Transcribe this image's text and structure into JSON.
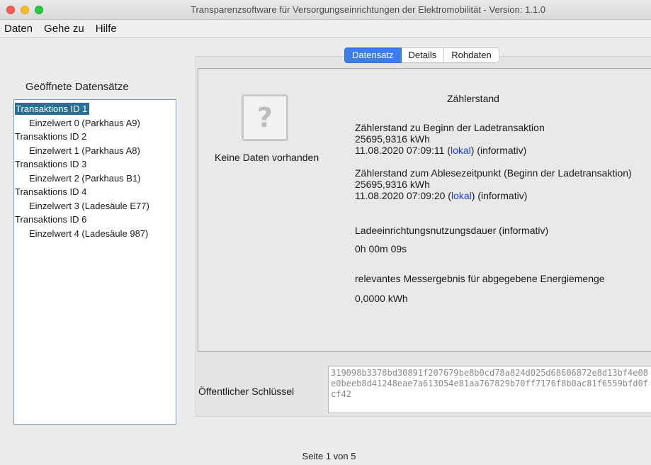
{
  "window": {
    "title": "Transparenzsoftware für Versorgungseinrichtungen der Elektromobilität - Version: 1.1.0"
  },
  "menu": [
    "Daten",
    "Gehe zu",
    "Hilfe"
  ],
  "sidebar": {
    "heading": "Geöffnete Datensätze",
    "items": [
      {
        "label": "Transaktions ID 1",
        "level": 0,
        "selected": true
      },
      {
        "label": "Einzelwert 0 (Parkhaus A9)",
        "level": 1
      },
      {
        "label": "Transaktions ID 2",
        "level": 0
      },
      {
        "label": "Einzelwert 1 (Parkhaus A8)",
        "level": 1
      },
      {
        "label": "Transaktions ID 3",
        "level": 0
      },
      {
        "label": "Einzelwert 2 (Parkhaus B1)",
        "level": 1
      },
      {
        "label": "Transaktions ID 4",
        "level": 0
      },
      {
        "label": "Einzelwert 3 (Ladesäule E77)",
        "level": 1
      },
      {
        "label": "Transaktions ID 6",
        "level": 0
      },
      {
        "label": "Einzelwert 4 (Ladesäule 987)",
        "level": 1
      }
    ]
  },
  "tabs": [
    {
      "label": "Datensatz",
      "active": true
    },
    {
      "label": "Details",
      "active": false
    },
    {
      "label": "Rohdaten",
      "active": false
    }
  ],
  "content": {
    "placeholder_icon": "question-mark-icon",
    "placeholder_glyph": "?",
    "no_data": "Keine Daten vorhanden",
    "meter_title": "Zählerstand",
    "start": {
      "label": "Zählerstand zu Beginn der Ladetransaktion",
      "value": "25695,9316 kWh",
      "timestamp": "11.08.2020 07:09:11",
      "lokal": "lokal",
      "info": "(informativ)"
    },
    "reading": {
      "label": "Zählerstand zum Ablesezeitpunkt (Beginn der Ladetransaktion)",
      "value": "25695,9316 kWh",
      "timestamp": "11.08.2020 07:09:20",
      "lokal": "lokal",
      "info": "(informativ)"
    },
    "duration": {
      "label": "Ladeeinrichtungsnutzungsdauer (informativ)",
      "value": "0h 00m 09s"
    },
    "energy": {
      "label": "relevantes Messergebnis für abgegebene Energiemenge",
      "value": "0,0000 kWh"
    }
  },
  "public_key": {
    "label": "Öffentlicher Schlüssel",
    "value": "319098b3378bd30891f207679be8b0cd78a824d025d68606872e8d13bf4e08e0beeb8d41248eae7a613054e81aa767829b70ff7176f8b0ac81f6559bfd0fcf42"
  },
  "footer": {
    "page": "Seite 1 von 5"
  }
}
